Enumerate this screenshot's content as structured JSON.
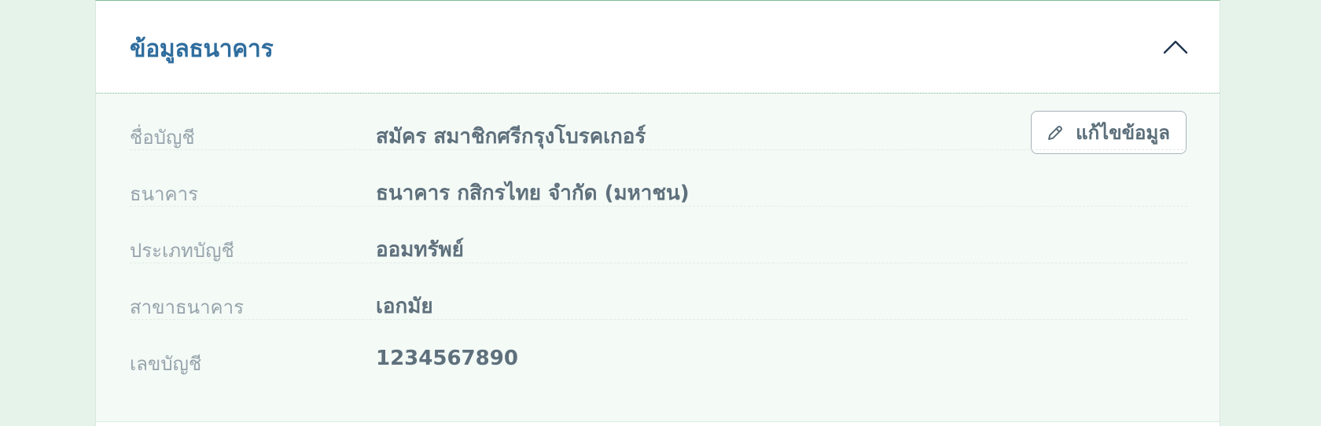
{
  "section": {
    "title": "ข้อมูลธนาคาร",
    "collapse_icon": "chevron-up-icon"
  },
  "edit_button": {
    "label": "แก้ไขข้อมูล",
    "icon": "pencil-icon"
  },
  "fields": [
    {
      "label": "ชื่อบัญชี",
      "value": "สมัคร สมาชิกศรีกรุงโบรคเกอร์"
    },
    {
      "label": "ธนาคาร",
      "value": "ธนาคาร กสิกรไทย จำกัด (มหาชน)"
    },
    {
      "label": "ประเภทบัญชี",
      "value": "ออมทรัพย์"
    },
    {
      "label": "สาขาธนาคาร",
      "value": "เอกมัย"
    },
    {
      "label": "เลขบัญชี",
      "value": "1234567890"
    }
  ],
  "colors": {
    "background": "#e6f3ea",
    "title": "#2f6d9e",
    "body_background": "#f4faf6",
    "value_text": "#5e707c",
    "label_text": "#97a4ac"
  }
}
